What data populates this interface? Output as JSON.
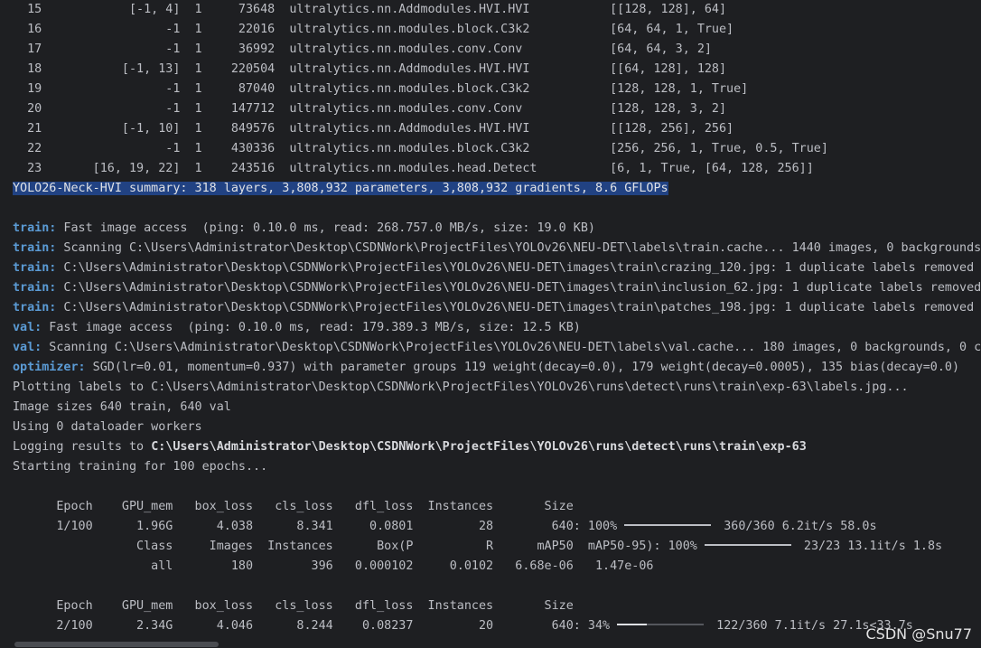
{
  "layer_rows": [
    "  15            [-1, 4]  1     73648  ultralytics.nn.Addmodules.HVI.HVI           [[128, 128], 64]",
    "  16                 -1  1     22016  ultralytics.nn.modules.block.C3k2           [64, 64, 1, True]",
    "  17                 -1  1     36992  ultralytics.nn.modules.conv.Conv            [64, 64, 3, 2]",
    "  18           [-1, 13]  1    220504  ultralytics.nn.Addmodules.HVI.HVI           [[64, 128], 128]",
    "  19                 -1  1     87040  ultralytics.nn.modules.block.C3k2           [128, 128, 1, True]",
    "  20                 -1  1    147712  ultralytics.nn.modules.conv.Conv            [128, 128, 3, 2]",
    "  21           [-1, 10]  1    849576  ultralytics.nn.Addmodules.HVI.HVI           [[128, 256], 256]",
    "  22                 -1  1    430336  ultralytics.nn.modules.block.C3k2           [256, 256, 1, True, 0.5, True]",
    "  23       [16, 19, 22]  1    243516  ultralytics.nn.modules.head.Detect          [6, 1, True, [64, 128, 256]]"
  ],
  "summary": "YOLO26-Neck-HVI summary: 318 layers, 3,808,932 parameters, 3,808,932 gradients, 8.6 GFLOPs",
  "log_lines": [
    {
      "key": "train:",
      "text": " Fast image access  (ping: 0.10.0 ms, read: 268.757.0 MB/s, size: 19.0 KB)"
    },
    {
      "key": "train:",
      "text": " Scanning C:\\Users\\Administrator\\Desktop\\CSDNWork\\ProjectFiles\\YOLOv26\\NEU-DET\\labels\\train.cache... 1440 images, 0 backgrounds,"
    },
    {
      "key": "train:",
      "text": " C:\\Users\\Administrator\\Desktop\\CSDNWork\\ProjectFiles\\YOLOv26\\NEU-DET\\images\\train\\crazing_120.jpg: 1 duplicate labels removed"
    },
    {
      "key": "train:",
      "text": " C:\\Users\\Administrator\\Desktop\\CSDNWork\\ProjectFiles\\YOLOv26\\NEU-DET\\images\\train\\inclusion_62.jpg: 1 duplicate labels removed"
    },
    {
      "key": "train:",
      "text": " C:\\Users\\Administrator\\Desktop\\CSDNWork\\ProjectFiles\\YOLOv26\\NEU-DET\\images\\train\\patches_198.jpg: 1 duplicate labels removed"
    },
    {
      "key": "val:",
      "text": " Fast image access  (ping: 0.10.0 ms, read: 179.389.3 MB/s, size: 12.5 KB)"
    },
    {
      "key": "val:",
      "text": " Scanning C:\\Users\\Administrator\\Desktop\\CSDNWork\\ProjectFiles\\YOLOv26\\NEU-DET\\labels\\val.cache... 180 images, 0 backgrounds, 0 co"
    },
    {
      "key": "optimizer:",
      "text": " SGD(lr=0.01, momentum=0.937) with parameter groups 119 weight(decay=0.0), 179 weight(decay=0.0005), 135 bias(decay=0.0)"
    }
  ],
  "plain_lines": [
    "Plotting labels to C:\\Users\\Administrator\\Desktop\\CSDNWork\\ProjectFiles\\YOLOv26\\runs\\detect\\runs\\train\\exp-63\\labels.jpg...",
    "Image sizes 640 train, 640 val",
    "Using 0 dataloader workers"
  ],
  "logging_prefix": "Logging results to ",
  "logging_path": "C:\\Users\\Administrator\\Desktop\\CSDNWork\\ProjectFiles\\YOLOv26\\runs\\detect\\runs\\train\\exp-63",
  "starting": "Starting training for 100 epochs...",
  "epoch_header": "      Epoch    GPU_mem   box_loss   cls_loss   dfl_loss  Instances       Size",
  "epoch1_prefix": "      1/100      1.96G      4.038      8.341     0.0801         28        640: 100%",
  "epoch1_suffix": " 360/360 6.2it/s 58.0s",
  "epoch1_progress": 1.0,
  "val_header_prefix": "                 Class     Images  Instances      Box(P          R      mAP50  mAP50-95): 100%",
  "val_header_suffix": " 23/23 13.1it/s 1.8s",
  "val_progress": 1.0,
  "val_row": "                   all        180        396   0.000102     0.0102   6.68e-06   1.47e-06",
  "epoch2_header": "      Epoch    GPU_mem   box_loss   cls_loss   dfl_loss  Instances       Size",
  "epoch2_prefix": "      2/100      2.34G      4.046      8.244    0.08237         20        640: 34%",
  "epoch2_suffix": " 122/360 7.1it/s 27.1s<33.7s",
  "epoch2_progress": 0.34,
  "watermark": "CSDN @Snu77",
  "colors": {
    "background": "#1e1f22",
    "text": "#bcbec4",
    "keyword": "#5b9bd5",
    "selection": "#214283"
  }
}
